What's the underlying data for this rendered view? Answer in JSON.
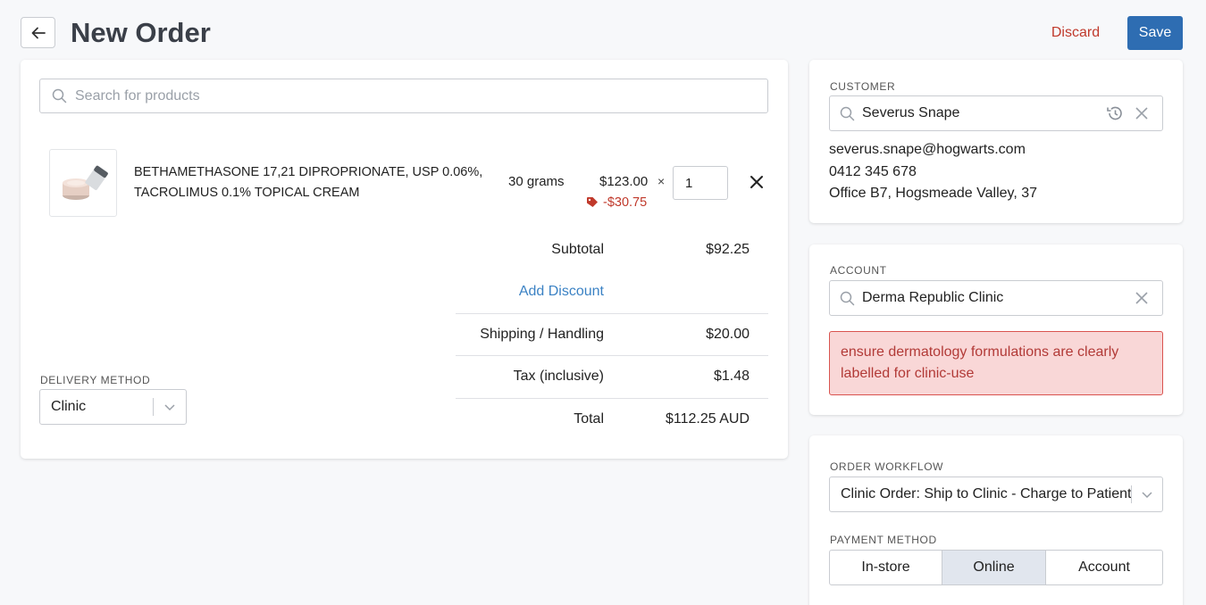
{
  "header": {
    "title": "New Order",
    "discard_label": "Discard",
    "save_label": "Save"
  },
  "colors": {
    "primary": "#2e6db2",
    "danger": "#c0392b",
    "link": "#3b82c4",
    "notice_bg": "#f9d7d7"
  },
  "product_search": {
    "placeholder": "Search for products"
  },
  "line_item": {
    "name_line1": "BETHAMETHASONE 17,21 DIPROPRIONATE, USP 0.06%,",
    "name_line2": "TACROLIMUS 0.1% TOPICAL CREAM",
    "size": "30 grams",
    "price": "$123.00",
    "times": "×",
    "discount": "-$30.75",
    "quantity": "1"
  },
  "summary": {
    "subtotal_label": "Subtotal",
    "subtotal_value": "$92.25",
    "add_discount_label": "Add Discount",
    "shipping_label": "Shipping / Handling",
    "shipping_value": "$20.00",
    "tax_label": "Tax (inclusive)",
    "tax_value": "$1.48",
    "total_label": "Total",
    "total_value": "$112.25 AUD"
  },
  "delivery": {
    "label": "DELIVERY METHOD",
    "selected": "Clinic"
  },
  "customer": {
    "label": "CUSTOMER",
    "name": "Severus Snape",
    "email": "severus.snape@hogwarts.com",
    "phone": "0412 345 678",
    "address": "Office B7, Hogsmeade Valley, 37"
  },
  "account": {
    "label": "ACCOUNT",
    "name": "Derma Republic Clinic",
    "notice": "ensure dermatology formulations are clearly labelled for clinic-use"
  },
  "workflow": {
    "label": "ORDER WORKFLOW",
    "selected": "Clinic Order: Ship to Clinic - Charge to Patient"
  },
  "payment": {
    "label": "PAYMENT METHOD",
    "options": [
      "In-store",
      "Online",
      "Account"
    ],
    "selected": "Online"
  }
}
